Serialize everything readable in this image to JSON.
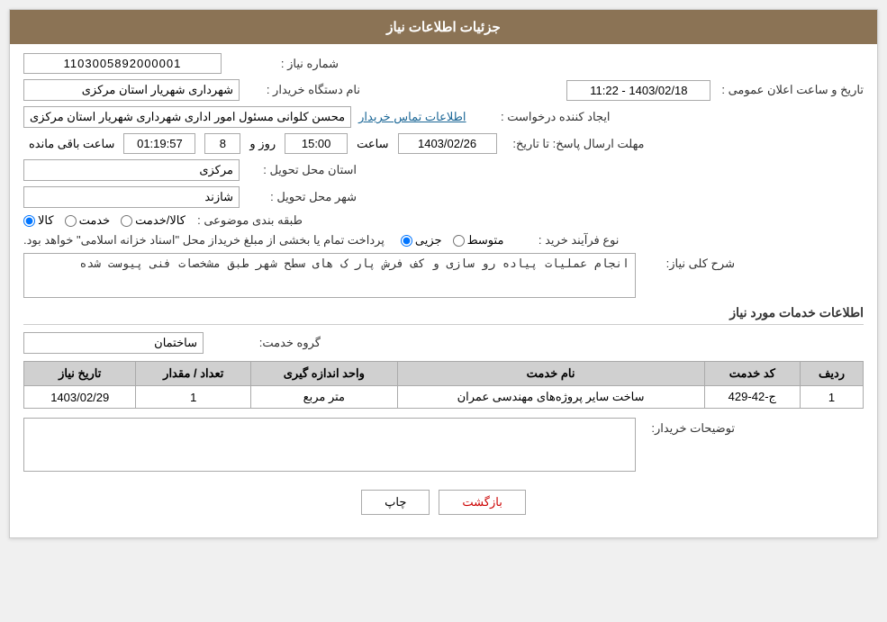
{
  "page": {
    "title": "جزئیات اطلاعات نیاز",
    "header": {
      "label_need_number": "شماره نیاز :",
      "need_number": "1103005892000001",
      "label_buyer_org": "نام دستگاه خریدار :",
      "buyer_org": "شهرداری شهریار استان مرکزی",
      "label_creator": "ایجاد کننده درخواست :",
      "creator": "محسن کلوانی مسئول امور اداری شهرداری شهریار استان مرکزی",
      "creator_link": "اطلاعات تماس خریدار",
      "label_deadline": "مهلت ارسال پاسخ: تا تاریخ:",
      "deadline_date": "1403/02/26",
      "label_time": "ساعت",
      "deadline_time": "15:00",
      "label_day": "روز و",
      "deadline_days": "8",
      "deadline_remaining": "01:19:57",
      "label_remaining": "ساعت باقی مانده",
      "label_delivery_province": "استان محل تحویل :",
      "delivery_province": "مرکزی",
      "label_delivery_city": "شهر محل تحویل :",
      "delivery_city": "شازند",
      "label_pub_datetime": "تاریخ و ساعت اعلان عمومی :",
      "pub_datetime": "1403/02/18 - 11:22",
      "label_category": "طبقه بندی موضوعی :",
      "radio_kala": "کالا",
      "radio_khedmat": "خدمت",
      "radio_kala_khedmat": "کالا/خدمت",
      "label_purchase_type": "نوع فرآیند خرید :",
      "radio_jozi": "جزیی",
      "radio_motavaset": "متوسط",
      "purchase_note": "پرداخت تمام یا بخشی از مبلغ خریداز محل \"اسناد خزانه اسلامی\" خواهد بود.",
      "label_need_desc": "شرح کلی نیاز:",
      "need_desc": "انجام عملیات پیاده رو سازی و کف فرش پار ک های سطح شهر طبق مشخصات فنی پیوست شده",
      "section_service_info": "اطلاعات خدمات مورد نیاز",
      "label_service_group": "گروه خدمت:",
      "service_group": "ساختمان",
      "table": {
        "col_row": "ردیف",
        "col_service_code": "کد خدمت",
        "col_service_name": "نام خدمت",
        "col_unit": "واحد اندازه گیری",
        "col_qty": "تعداد / مقدار",
        "col_date": "تاریخ نیاز",
        "rows": [
          {
            "row": "1",
            "service_code": "ج-42-429",
            "service_name": "ساخت سایر پروژه‌های مهندسی عمران",
            "unit": "متر مربع",
            "qty": "1",
            "date": "1403/02/29"
          }
        ]
      },
      "label_buyer_notes": "توضیحات خریدار:",
      "buyer_notes": "",
      "btn_back": "بازگشت",
      "btn_print": "چاپ"
    }
  }
}
